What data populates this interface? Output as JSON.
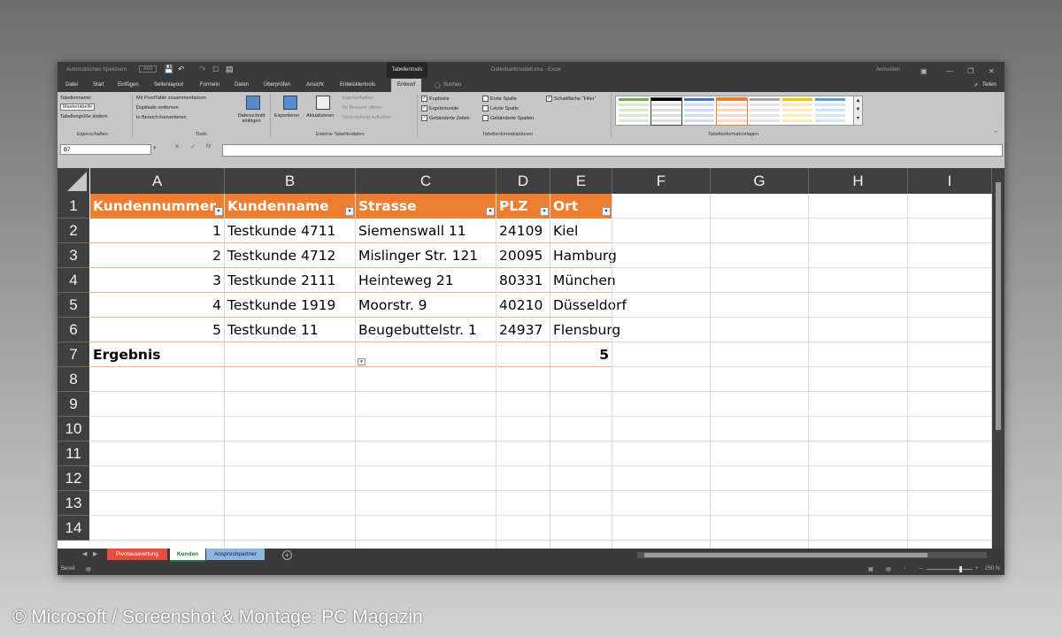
{
  "titlebar": {
    "autosave": "Automatisches Speichern",
    "autosave_state": "Aus",
    "context": "Tabellentools",
    "title": "Datenbankmodell.xlsx  -  Excel",
    "signin": "Anmelden"
  },
  "tabs": [
    "Datei",
    "Start",
    "Einfügen",
    "Seitenlayout",
    "Formeln",
    "Daten",
    "Überprüfen",
    "Ansicht",
    "Entwicklertools",
    "Entwurf"
  ],
  "tell_me": "Suchen",
  "share": "Teilen",
  "ribbon": {
    "props": {
      "table_name_label": "Tabellenname:",
      "table_name": "Mastertabelle",
      "resize": "Tabellengröße ändern",
      "group": "Eigenschaften"
    },
    "tools": {
      "pivot": "Mit PivotTable zusammenfassen",
      "dupes": "Duplikate entfernen",
      "convert": "In Bereich konvertieren",
      "slicer": "Datenschnitt einfügen",
      "group": "Tools"
    },
    "external": {
      "export": "Exportieren",
      "refresh": "Aktualisieren",
      "props": "Eigenschaften",
      "browser": "Im Browser öffnen",
      "unlink": "Verknüpfung aufheben",
      "group": "Externe Tabellendaten"
    },
    "style_options": {
      "header_row": "Kopfzeile",
      "total_row": "Ergebniszeile",
      "banded_rows": "Gebänderte Zeilen",
      "first_col": "Erste Spalte",
      "last_col": "Letzte Spalte",
      "banded_cols": "Gebänderte Spalten",
      "filter_btn": "Schaltfläche \"Filter\"",
      "group": "Tabellenformatoptionen"
    },
    "styles_group": "Tabellenformatvorlagen"
  },
  "namebox": "B7",
  "columns": [
    "A",
    "B",
    "C",
    "D",
    "E",
    "F",
    "G",
    "H",
    "I"
  ],
  "rows": [
    "1",
    "2",
    "3",
    "4",
    "5",
    "6",
    "7",
    "8",
    "9",
    "10",
    "11",
    "12",
    "13",
    "14"
  ],
  "table": {
    "headers": [
      "Kundennummer",
      "Kundenname",
      "Strasse",
      "PLZ",
      "Ort"
    ],
    "data": [
      [
        "1",
        "Testkunde 4711",
        "Siemenswall 11",
        "24109",
        "Kiel"
      ],
      [
        "2",
        "Testkunde 4712",
        "Mislinger Str. 121",
        "20095",
        "Hamburg"
      ],
      [
        "3",
        "Testkunde 2111",
        "Heinteweg 21",
        "80331",
        "München"
      ],
      [
        "4",
        "Testkunde 1919",
        "Moorstr. 9",
        "40210",
        "Düsseldorf"
      ],
      [
        "5",
        "Testkunde 11",
        "Beugebuttelstr. 1",
        "24937",
        "Flensburg"
      ]
    ],
    "total_label": "Ergebnis",
    "total_value": "5"
  },
  "sheets": [
    "Pivotauswertung",
    "Kunden",
    "Ansprechpartner"
  ],
  "sheet_colors": [
    "#e84c3d",
    "#ffffff",
    "#8eb4e3"
  ],
  "status": {
    "ready": "Bereit",
    "zoom": "250 %"
  },
  "credit": "© Microsoft / Screenshot & Montage: PC Magazin",
  "colors": {
    "accent": "#ed7d31",
    "header_bg": "#3f3f3f"
  }
}
